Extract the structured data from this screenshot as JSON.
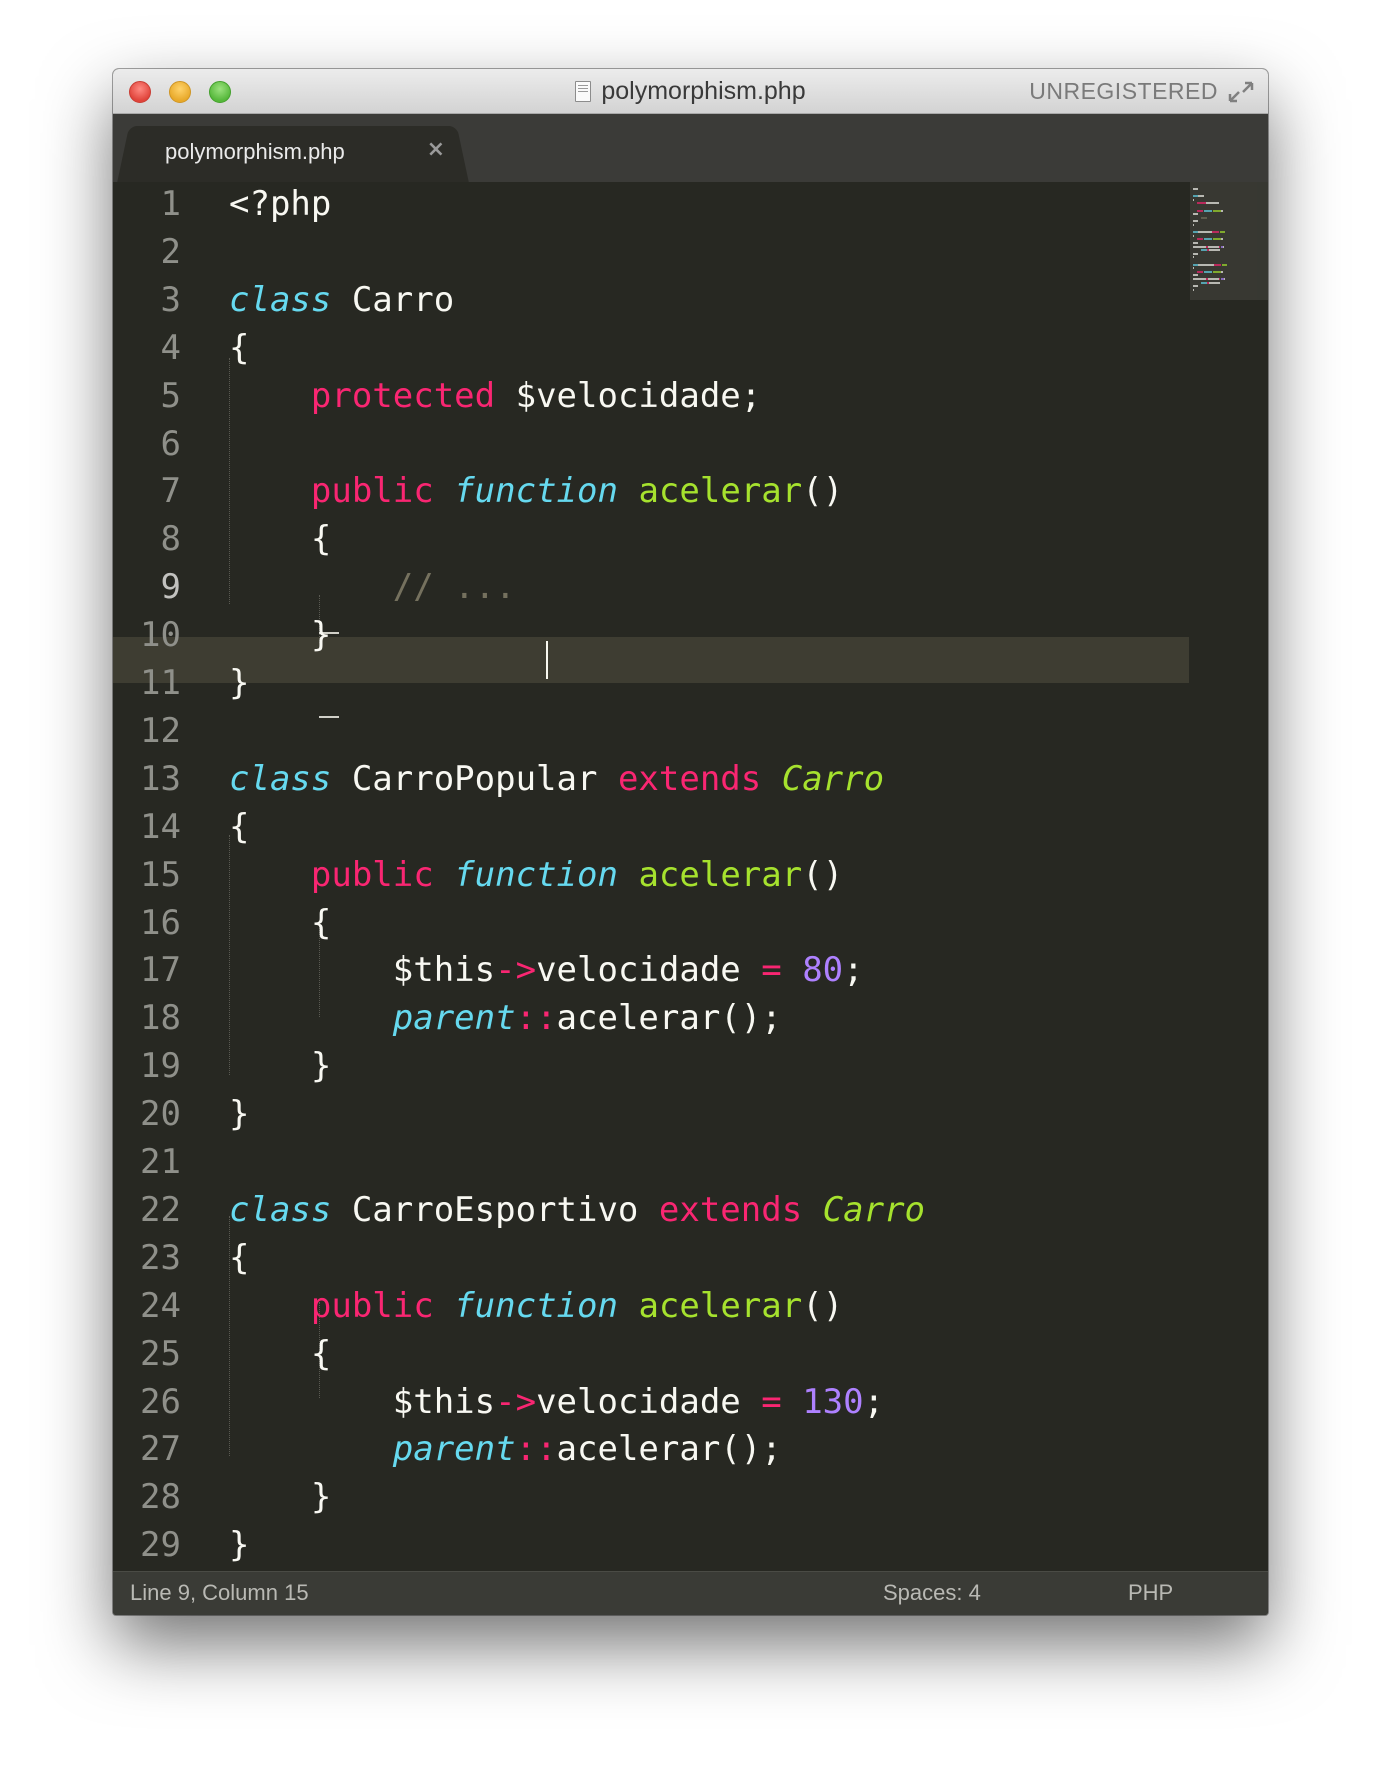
{
  "window": {
    "title": "polymorphism.php",
    "unregistered_label": "UNREGISTERED"
  },
  "tabs": [
    {
      "label": "polymorphism.php",
      "close_glyph": "×",
      "active": true
    }
  ],
  "editor": {
    "language": "PHP",
    "current_line": 9,
    "line_numbers": [
      "1",
      "2",
      "3",
      "4",
      "5",
      "6",
      "7",
      "8",
      "9",
      "10",
      "11",
      "12",
      "13",
      "14",
      "15",
      "16",
      "17",
      "18",
      "19",
      "20",
      "21",
      "22",
      "23",
      "24",
      "25",
      "26",
      "27",
      "28",
      "29"
    ],
    "lines": [
      [
        {
          "t": "<?php",
          "c": "plain"
        }
      ],
      [],
      [
        {
          "t": "class",
          "c": "storage"
        },
        {
          "t": " Carro",
          "c": "plain"
        }
      ],
      [
        {
          "t": "{",
          "c": "plain"
        }
      ],
      [
        {
          "t": "    ",
          "c": "plain"
        },
        {
          "t": "protected",
          "c": "keyword"
        },
        {
          "t": " $velocidade;",
          "c": "plain"
        }
      ],
      [],
      [
        {
          "t": "    ",
          "c": "plain"
        },
        {
          "t": "public",
          "c": "keyword"
        },
        {
          "t": " ",
          "c": "plain"
        },
        {
          "t": "function",
          "c": "storage"
        },
        {
          "t": " ",
          "c": "plain"
        },
        {
          "t": "acelerar",
          "c": "function"
        },
        {
          "t": "()",
          "c": "plain"
        }
      ],
      [
        {
          "t": "    {",
          "c": "plain"
        }
      ],
      [
        {
          "t": "        ",
          "c": "plain"
        },
        {
          "t": "// ...",
          "c": "comment"
        }
      ],
      [
        {
          "t": "    }",
          "c": "plain"
        }
      ],
      [
        {
          "t": "}",
          "c": "plain"
        }
      ],
      [],
      [
        {
          "t": "class",
          "c": "storage"
        },
        {
          "t": " CarroPopular ",
          "c": "plain"
        },
        {
          "t": "extends",
          "c": "keyword"
        },
        {
          "t": " ",
          "c": "plain"
        },
        {
          "t": "Carro",
          "c": "class"
        }
      ],
      [
        {
          "t": "{",
          "c": "plain"
        }
      ],
      [
        {
          "t": "    ",
          "c": "plain"
        },
        {
          "t": "public",
          "c": "keyword"
        },
        {
          "t": " ",
          "c": "plain"
        },
        {
          "t": "function",
          "c": "storage"
        },
        {
          "t": " ",
          "c": "plain"
        },
        {
          "t": "acelerar",
          "c": "function"
        },
        {
          "t": "()",
          "c": "plain"
        }
      ],
      [
        {
          "t": "    {",
          "c": "plain"
        }
      ],
      [
        {
          "t": "        $this",
          "c": "plain"
        },
        {
          "t": "->",
          "c": "keyword"
        },
        {
          "t": "velocidade ",
          "c": "plain"
        },
        {
          "t": "=",
          "c": "keyword"
        },
        {
          "t": " ",
          "c": "plain"
        },
        {
          "t": "80",
          "c": "number"
        },
        {
          "t": ";",
          "c": "plain"
        }
      ],
      [
        {
          "t": "        ",
          "c": "plain"
        },
        {
          "t": "parent",
          "c": "storage"
        },
        {
          "t": "::",
          "c": "keyword"
        },
        {
          "t": "acelerar();",
          "c": "plain"
        }
      ],
      [
        {
          "t": "    }",
          "c": "plain"
        }
      ],
      [
        {
          "t": "}",
          "c": "plain"
        }
      ],
      [],
      [
        {
          "t": "class",
          "c": "storage"
        },
        {
          "t": " CarroEsportivo ",
          "c": "plain"
        },
        {
          "t": "extends",
          "c": "keyword"
        },
        {
          "t": " ",
          "c": "plain"
        },
        {
          "t": "Carro",
          "c": "class"
        }
      ],
      [
        {
          "t": "{",
          "c": "plain"
        }
      ],
      [
        {
          "t": "    ",
          "c": "plain"
        },
        {
          "t": "public",
          "c": "keyword"
        },
        {
          "t": " ",
          "c": "plain"
        },
        {
          "t": "function",
          "c": "storage"
        },
        {
          "t": " ",
          "c": "plain"
        },
        {
          "t": "acelerar",
          "c": "function"
        },
        {
          "t": "()",
          "c": "plain"
        }
      ],
      [
        {
          "t": "    {",
          "c": "plain"
        }
      ],
      [
        {
          "t": "        $this",
          "c": "plain"
        },
        {
          "t": "->",
          "c": "keyword"
        },
        {
          "t": "velocidade ",
          "c": "plain"
        },
        {
          "t": "=",
          "c": "keyword"
        },
        {
          "t": " ",
          "c": "plain"
        },
        {
          "t": "130",
          "c": "number"
        },
        {
          "t": ";",
          "c": "plain"
        }
      ],
      [
        {
          "t": "        ",
          "c": "plain"
        },
        {
          "t": "parent",
          "c": "storage"
        },
        {
          "t": "::",
          "c": "keyword"
        },
        {
          "t": "acelerar();",
          "c": "plain"
        }
      ],
      [
        {
          "t": "    }",
          "c": "plain"
        }
      ],
      [
        {
          "t": "}",
          "c": "plain"
        }
      ]
    ]
  },
  "status_bar": {
    "position": "Line 9, Column 15",
    "indentation": "Spaces: 4",
    "syntax": "PHP"
  },
  "colors": {
    "background": "#272822",
    "keyword": "#f92672",
    "storage": "#66d9ef",
    "function": "#a6e22e",
    "number": "#ae81ff",
    "comment": "#75715e",
    "text": "#f8f8f2"
  }
}
